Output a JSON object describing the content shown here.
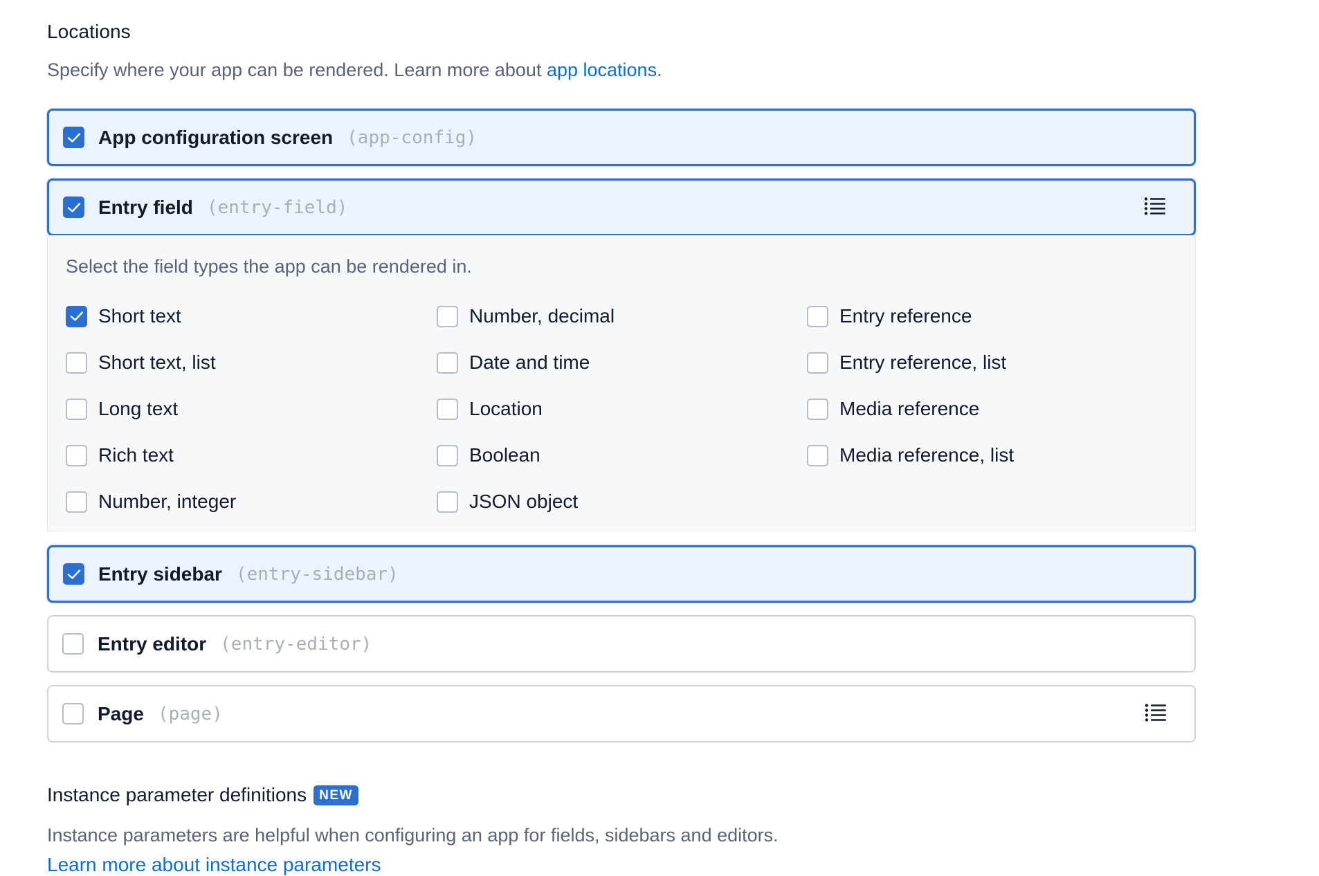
{
  "locations": {
    "title": "Locations",
    "description": "Specify where your app can be rendered. Learn more about ",
    "description_link": "app locations",
    "description_suffix": ".",
    "items": [
      {
        "label": "App configuration screen",
        "code": "(app-config)",
        "checked": true
      },
      {
        "label": "Entry field",
        "code": "(entry-field)",
        "checked": true
      },
      {
        "label": "Entry sidebar",
        "code": "(entry-sidebar)",
        "checked": true
      },
      {
        "label": "Entry editor",
        "code": "(entry-editor)",
        "checked": false
      },
      {
        "label": "Page",
        "code": "(page)",
        "checked": false
      }
    ]
  },
  "field_types": {
    "prompt": "Select the field types the app can be rendered in.",
    "items": [
      {
        "label": "Short text",
        "checked": true
      },
      {
        "label": "Short text, list",
        "checked": false
      },
      {
        "label": "Long text",
        "checked": false
      },
      {
        "label": "Rich text",
        "checked": false
      },
      {
        "label": "Number, integer",
        "checked": false
      },
      {
        "label": "Number, decimal",
        "checked": false
      },
      {
        "label": "Date and time",
        "checked": false
      },
      {
        "label": "Location",
        "checked": false
      },
      {
        "label": "Boolean",
        "checked": false
      },
      {
        "label": "JSON object",
        "checked": false
      },
      {
        "label": "Entry reference",
        "checked": false
      },
      {
        "label": "Entry reference, list",
        "checked": false
      },
      {
        "label": "Media reference",
        "checked": false
      },
      {
        "label": "Media reference, list",
        "checked": false
      }
    ]
  },
  "instance_parameters": {
    "title": "Instance parameter definitions",
    "badge": "NEW",
    "description": "Instance parameters are helpful when configuring an app for fields, sidebars and editors.",
    "link": "Learn more about instance parameters"
  },
  "colors": {
    "accent": "#2a6fd1",
    "link": "#0a6dd8",
    "selected_background": "#edf3fc",
    "panel_background": "#f6f8fa"
  }
}
